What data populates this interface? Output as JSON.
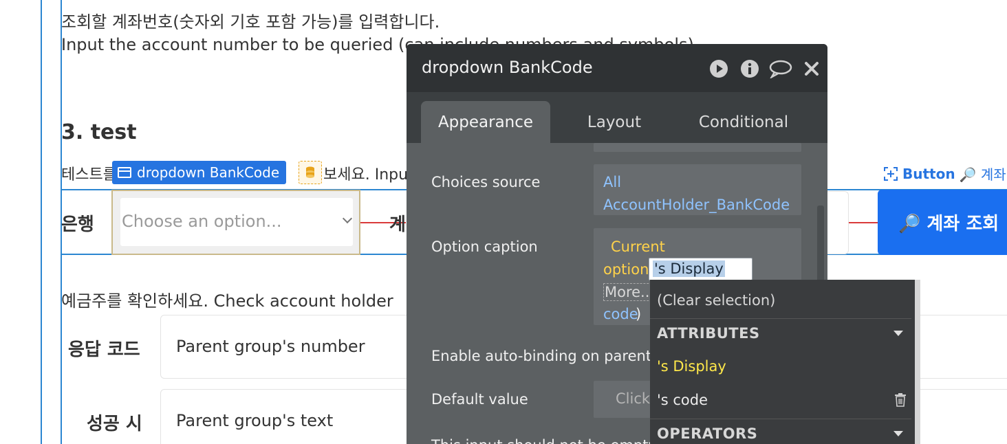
{
  "page": {
    "line1_ko": "조회할 계좌번호(숫자외 기호 포함 가능)를 입력합니다.",
    "line2_en": "Input the account number to be queried (can include numbers and symbols)",
    "section_heading": "3. test",
    "test_line_prefix": "테스트를",
    "test_line_suffix": "보세요. Inpu",
    "bank_label": "은행",
    "select_placeholder": "Choose an option...",
    "account_label_partial": "계",
    "holder_prompt": "예금주를 확인하세요. Check account holder",
    "response_code_label": "응답 코드",
    "response_code_value": "Parent group's number",
    "success_label": "성공 시",
    "success_value": "Parent group's text",
    "search_button": "🔎 계좌 조회",
    "button_element_label": "Button",
    "button_element_suffix": "🔎 계좌 ..."
  },
  "selected_element": {
    "chip_label": "dropdown BankCode"
  },
  "panel": {
    "title": "dropdown BankCode",
    "tabs": [
      "Appearance",
      "Layout",
      "Conditional"
    ],
    "active_tab": "Appearance",
    "choices_source_label": "Choices source",
    "choices_source_value_1": "All",
    "choices_source_value_2": "AccountHolder_BankCode",
    "option_caption_label": "Option caption",
    "caption_current": "Current",
    "caption_option": "option",
    "caption_input_value": "'s Display",
    "caption_more": "More...",
    "caption_code": "code",
    "caption_paren": ")",
    "auto_binding_label": "Enable auto-binding on parent e",
    "default_value_label": "Default value",
    "default_value_placeholder": "Click",
    "cut_label": "This input should not be empty"
  },
  "dropdown_menu": {
    "clear": "(Clear selection)",
    "attributes_header": "ATTRIBUTES",
    "item_display": "'s Display",
    "item_code": "'s code",
    "operators_header": "OPERATORS"
  },
  "colors": {
    "accent_blue": "#2674e0",
    "panel_bg": "#5c6062",
    "panel_header": "#2f3234",
    "highlight_yellow": "#ffd24a",
    "link_blue": "#8fc3ff"
  }
}
